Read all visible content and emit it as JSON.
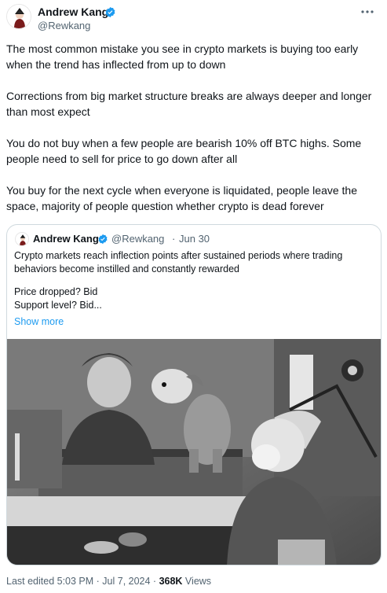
{
  "author": {
    "name": "Andrew Kang",
    "handle": "@Rewkang",
    "verified": true,
    "verified_color": "#1d9bf0"
  },
  "menu_icon": "more-horizontal-icon",
  "tweet": {
    "paragraphs": [
      "The most common mistake you see in crypto markets is buying too early when the trend has inflected from up to down",
      "Corrections from big market structure breaks are always deeper and longer than most expect",
      "You do not buy when a few people are bearish 10% off BTC highs. Some people need to sell for price to go down after all",
      "You buy for the next cycle when everyone is liquidated, people leave the space, majority of people question whether crypto is dead forever"
    ]
  },
  "quoted_tweet": {
    "name": "Andrew Kang",
    "handle": "@Rewkang",
    "separator": "·",
    "date": "Jun 30",
    "lines": [
      "Crypto markets reach inflection points after sustained periods where trading behaviors become instilled and constantly rewarded",
      "Price dropped? Bid",
      "Support level? Bid..."
    ],
    "show_more": "Show more",
    "image_icon": "historic-photo-dog-experiment"
  },
  "footer": {
    "edited": "Last edited 5:03 PM · Jul 7, 2024 · ",
    "views_count": "368K",
    "views_label": " Views"
  },
  "colors": {
    "text": "#0f1419",
    "secondary": "#536471",
    "link": "#1d9bf0",
    "border": "#cfd9de"
  }
}
